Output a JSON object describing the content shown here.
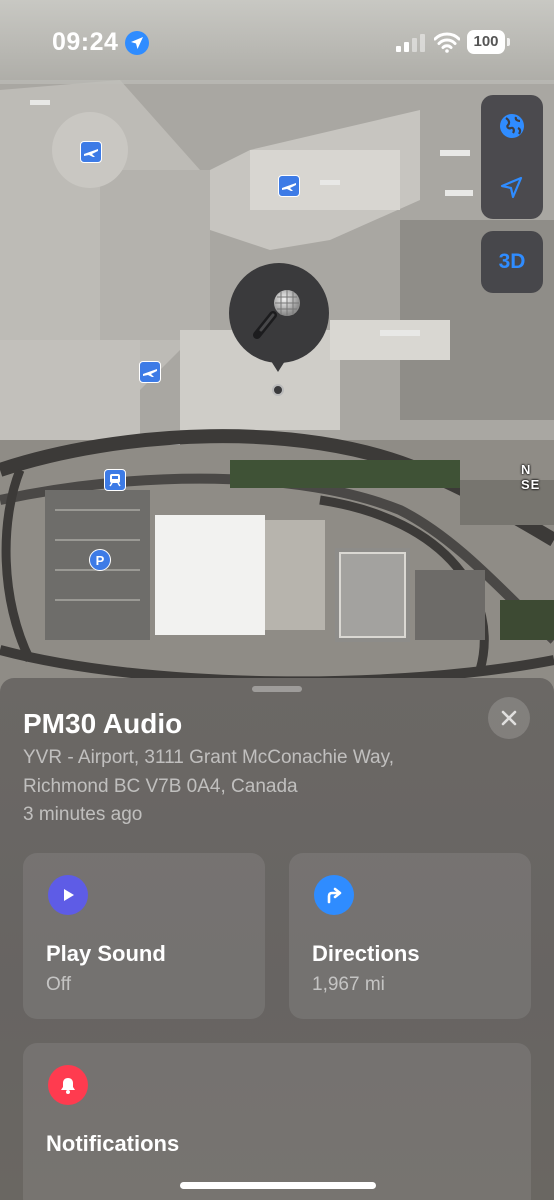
{
  "status_bar": {
    "time": "09:24",
    "battery": "100",
    "icons": [
      "location-arrow-icon",
      "cellular-signal-icon",
      "wifi-icon",
      "battery-icon"
    ]
  },
  "map": {
    "controls": [
      "globe-icon",
      "location-icon"
    ],
    "view_3d_label": "3D",
    "road_label": "N SE",
    "pin_icon": "microphone-icon",
    "poi_icons": [
      "airport-icon",
      "airport-icon",
      "airport-icon",
      "train-icon",
      "parking-icon"
    ],
    "parking_glyph": "P"
  },
  "sheet": {
    "title": "PM30 Audio",
    "address_line1": "YVR - Airport, 3111 Grant McConachie Way,",
    "address_line2": "Richmond BC V7B 0A4, Canada",
    "last_seen": "3 minutes ago",
    "actions": [
      {
        "label": "Play Sound",
        "value": "Off",
        "icon": "play-icon",
        "color": "#5e5ce6"
      },
      {
        "label": "Directions",
        "value": "1,967 mi",
        "icon": "directions-arrow-icon",
        "color": "#2f8cff"
      }
    ],
    "notifications": {
      "label": "Notifications",
      "icon": "bell-icon",
      "color": "#ff3b4f"
    }
  },
  "colors": {
    "accent": "#2f8cff",
    "sheet_bg": "#6a6764"
  }
}
